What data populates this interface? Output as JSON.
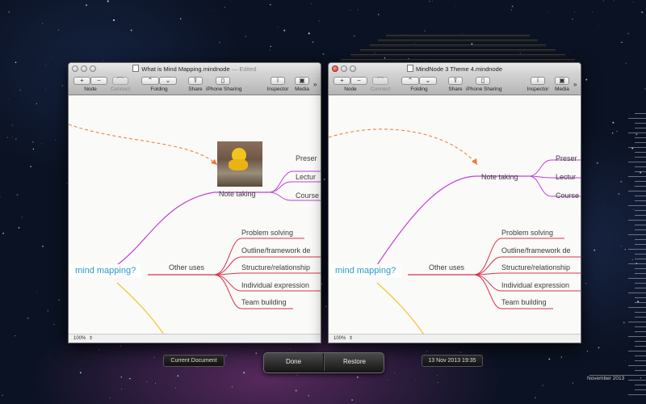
{
  "windows": [
    {
      "title": "What is Mind Mapping.mindnode",
      "title_suffix": "— Edited",
      "toolbar": {
        "node_label": "Node",
        "connect_label": "Connect",
        "folding_label": "Folding",
        "share_label": "Share",
        "iphone_sharing_label": "iPhone Sharing",
        "inspector_label": "Inspector",
        "media_label": "Media"
      },
      "nodes": {
        "root": "mind mapping?",
        "note_taking": "Note taking",
        "presentation": "Preser",
        "lectures": "Lectur",
        "courses": "Course",
        "other_uses": "Other uses",
        "problem_solving": "Problem solving",
        "outline": "Outline/framework de",
        "structure": "Structure/relationship",
        "individual_expression": "Individual expression",
        "team_building": "Team building"
      },
      "zoom": "100%"
    },
    {
      "title": "MindNode 3 Theme 4.mindnode",
      "title_suffix": "",
      "toolbar": {
        "node_label": "Node",
        "connect_label": "Connect",
        "folding_label": "Folding",
        "share_label": "Share",
        "iphone_sharing_label": "iPhone Sharing",
        "inspector_label": "Inspector",
        "media_label": "Media"
      },
      "nodes": {
        "root": "mind mapping?",
        "note_taking": "Note taking",
        "presentation": "Preser",
        "lectures": "Lectur",
        "courses": "Course",
        "other_uses": "Other uses",
        "problem_solving": "Problem solving",
        "outline": "Outline/framework de",
        "structure": "Structure/relationship",
        "individual_expression": "Individual expression",
        "team_building": "Team building"
      },
      "zoom": "100%"
    }
  ],
  "controls": {
    "current_document_label": "Current Document",
    "done_label": "Done",
    "restore_label": "Restore",
    "version_date": "13 Nov 2013 19:35"
  },
  "timeline": {
    "month_label": "November 2013"
  },
  "colors": {
    "accent_blue": "#2a9ac8",
    "branch_purple": "#c040d8",
    "branch_red": "#d8304c",
    "branch_yellow": "#f4c430",
    "arrow_orange": "#f07838"
  }
}
